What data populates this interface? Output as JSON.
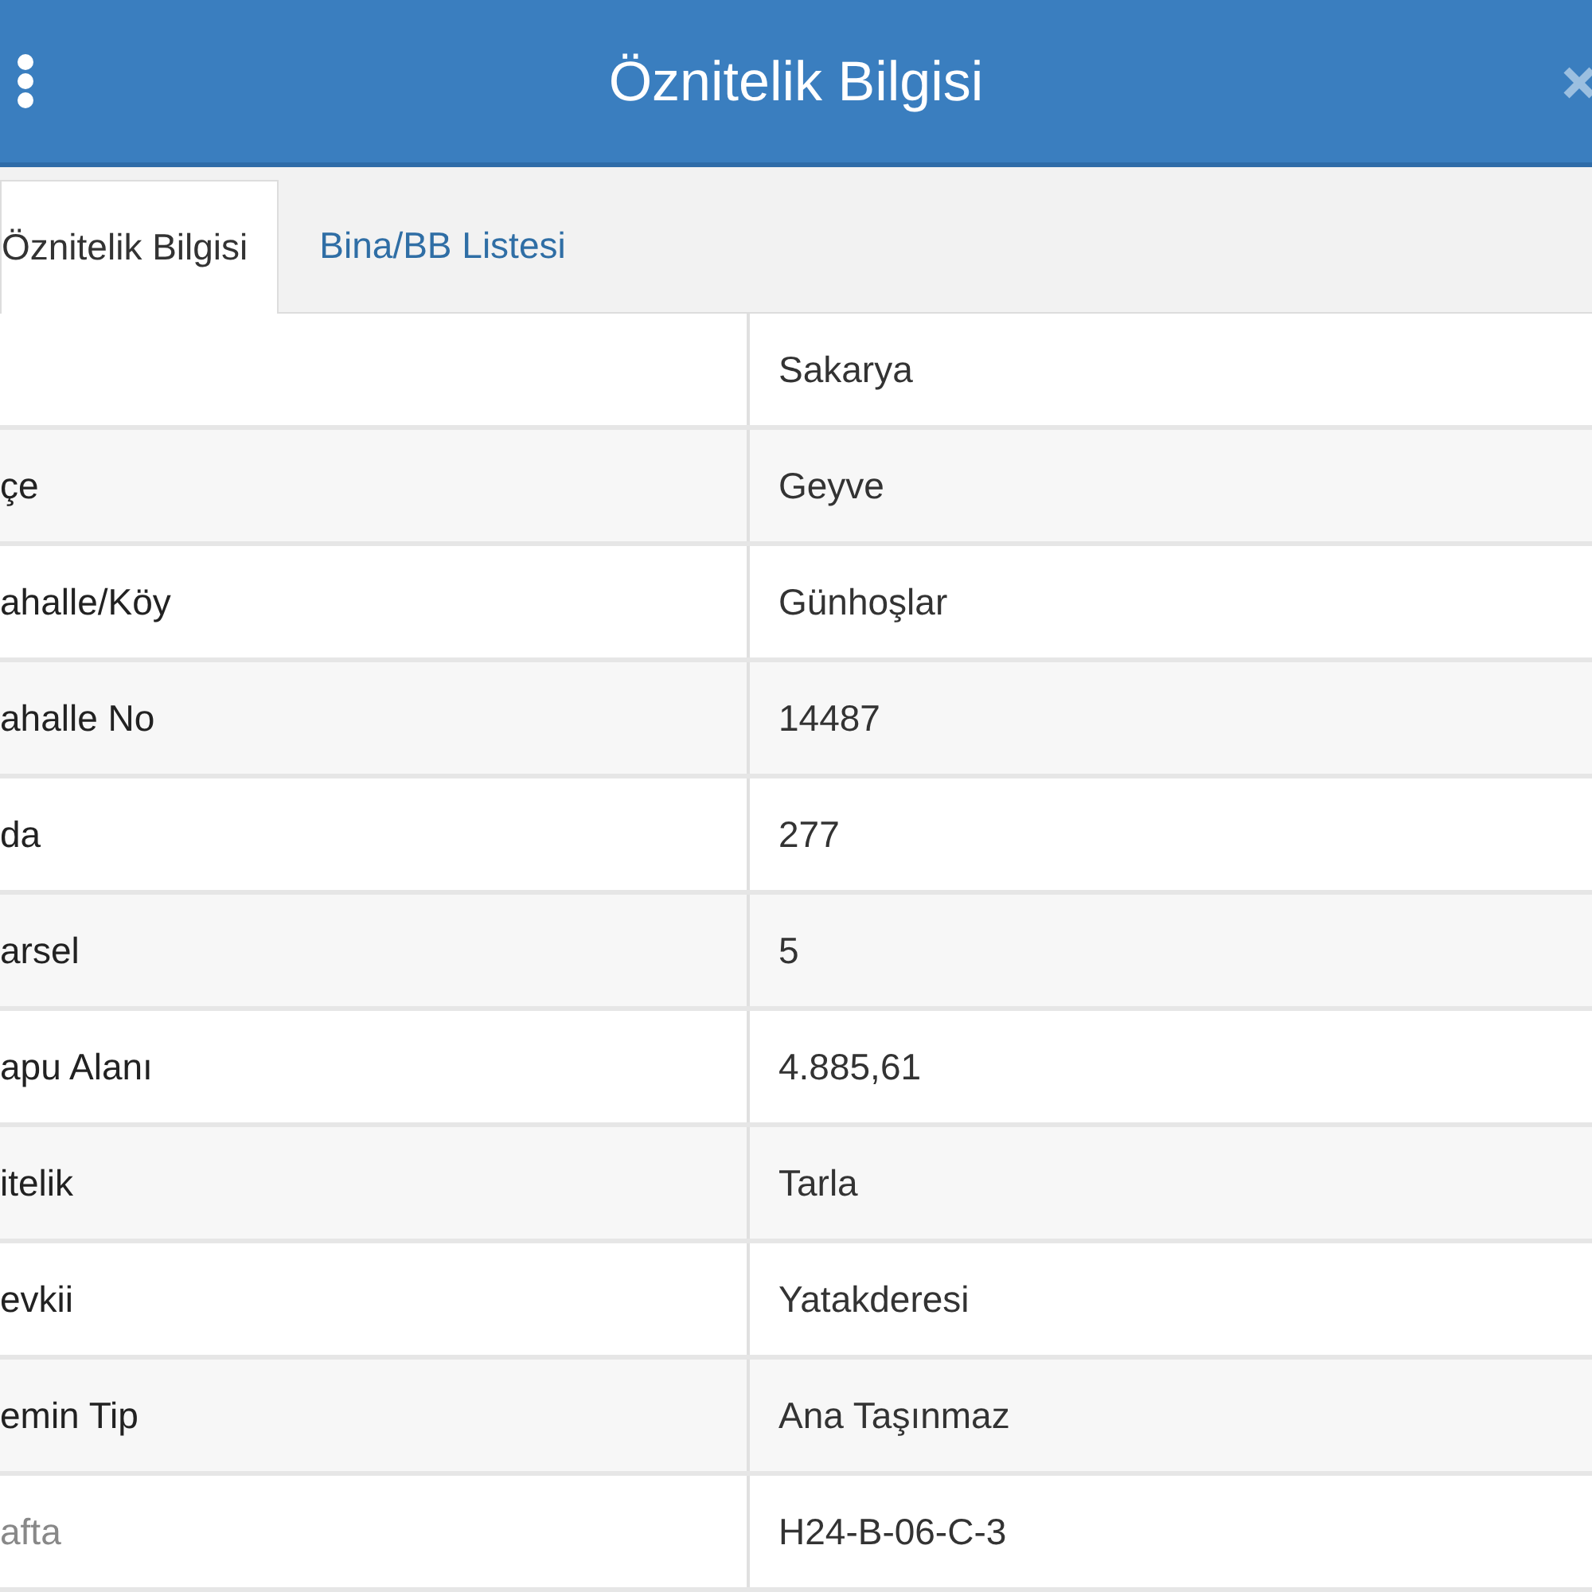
{
  "header": {
    "title": "Öznitelik Bilgisi"
  },
  "tabs": [
    {
      "label": "Öznitelik Bilgisi",
      "selected": true
    },
    {
      "label": "Bina/BB Listesi",
      "selected": false
    }
  ],
  "rows": [
    {
      "label": "",
      "value": "Sakarya"
    },
    {
      "label": "çe",
      "value": "Geyve"
    },
    {
      "label": "ahalle/Köy",
      "value": "Günhoşlar"
    },
    {
      "label": "ahalle No",
      "value": "14487"
    },
    {
      "label": "da",
      "value": "277"
    },
    {
      "label": "arsel",
      "value": "5"
    },
    {
      "label": "apu Alanı",
      "value": "4.885,61"
    },
    {
      "label": "itelik",
      "value": "Tarla"
    },
    {
      "label": "evkii",
      "value": "Yatakderesi"
    },
    {
      "label": "emin Tip",
      "value": "Ana Taşınmaz"
    },
    {
      "label": "afta",
      "value": "H24-B-06-C-3"
    }
  ]
}
